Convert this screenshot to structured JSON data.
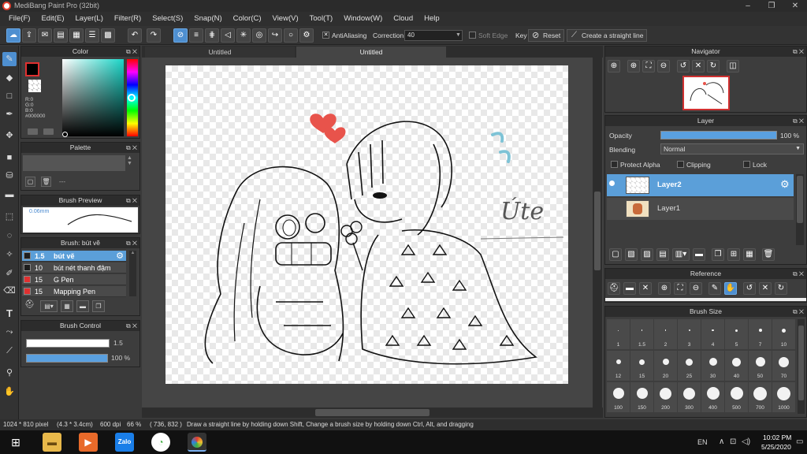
{
  "window": {
    "title": "MediBang Paint Pro (32bit)",
    "minimize": "–",
    "maximize": "❐",
    "close": "✕"
  },
  "menu": [
    "File(F)",
    "Edit(E)",
    "Layer(L)",
    "Filter(R)",
    "Select(S)",
    "Snap(N)",
    "Color(C)",
    "View(V)",
    "Tool(T)",
    "Window(W)",
    "Cloud",
    "Help"
  ],
  "toolbar": {
    "antialias_label": "AntiAliasing",
    "correction_label": "Correction",
    "correction_value": "40",
    "softedge_label": "Soft Edge",
    "key_label": "Key",
    "reset_label": "Reset",
    "straight_label": "Create a straight line"
  },
  "color_panel": {
    "title": "Color",
    "r": "R:0",
    "g": "G:0",
    "b": "B:0",
    "hex": "#000000"
  },
  "palette_panel": {
    "title": "Palette",
    "entry": "---"
  },
  "brush_preview": {
    "title": "Brush Preview",
    "size": "0.06mm"
  },
  "brush_panel": {
    "title": "Brush: bút vẽ",
    "items": [
      {
        "size": "1.5",
        "name": "bút vẽ",
        "color": "#1e1e1e",
        "selected": true
      },
      {
        "size": "10",
        "name": "bút nét thanh đậm",
        "color": "#1e1e1e",
        "selected": false
      },
      {
        "size": "15",
        "name": "G Pen",
        "color": "#e03030",
        "selected": false
      },
      {
        "size": "15",
        "name": "Mapping Pen",
        "color": "#e03030",
        "selected": false
      }
    ]
  },
  "brush_control": {
    "title": "Brush Control",
    "size_value": "1.5",
    "opacity_value": "100 %"
  },
  "tabs": [
    "Untitled",
    "Untitled"
  ],
  "canvas_text": "Úte",
  "navigator": {
    "title": "Navigator"
  },
  "layer_panel": {
    "title": "Layer",
    "opacity_label": "Opacity",
    "opacity_value": "100 %",
    "blending_label": "Blending",
    "blending_value": "Normal",
    "protect_alpha": "Protect Alpha",
    "clipping": "Clipping",
    "lock": "Lock",
    "layers": [
      {
        "name": "Layer2",
        "selected": true
      },
      {
        "name": "Layer1",
        "selected": false
      }
    ]
  },
  "reference": {
    "title": "Reference"
  },
  "brush_size": {
    "title": "Brush Size",
    "sizes": [
      "1",
      "1.5",
      "2",
      "3",
      "4",
      "5",
      "7",
      "10",
      "12",
      "15",
      "20",
      "25",
      "30",
      "40",
      "50",
      "70",
      "100",
      "150",
      "200",
      "300",
      "400",
      "500",
      "700",
      "1000"
    ]
  },
  "status": {
    "dimensions": "1024 * 810 pixel",
    "physical": "(4.3 * 3.4cm)",
    "dpi": "600 dpi",
    "zoom": "66 %",
    "coords": "( 736, 832 )",
    "hint": "Draw a straight line by holding down Shift, Change a brush size by holding down Ctrl, Alt, and dragging"
  },
  "taskbar": {
    "lang": "EN",
    "time": "10:02 PM",
    "date": "5/25/2020",
    "zalo": "Zalo"
  }
}
